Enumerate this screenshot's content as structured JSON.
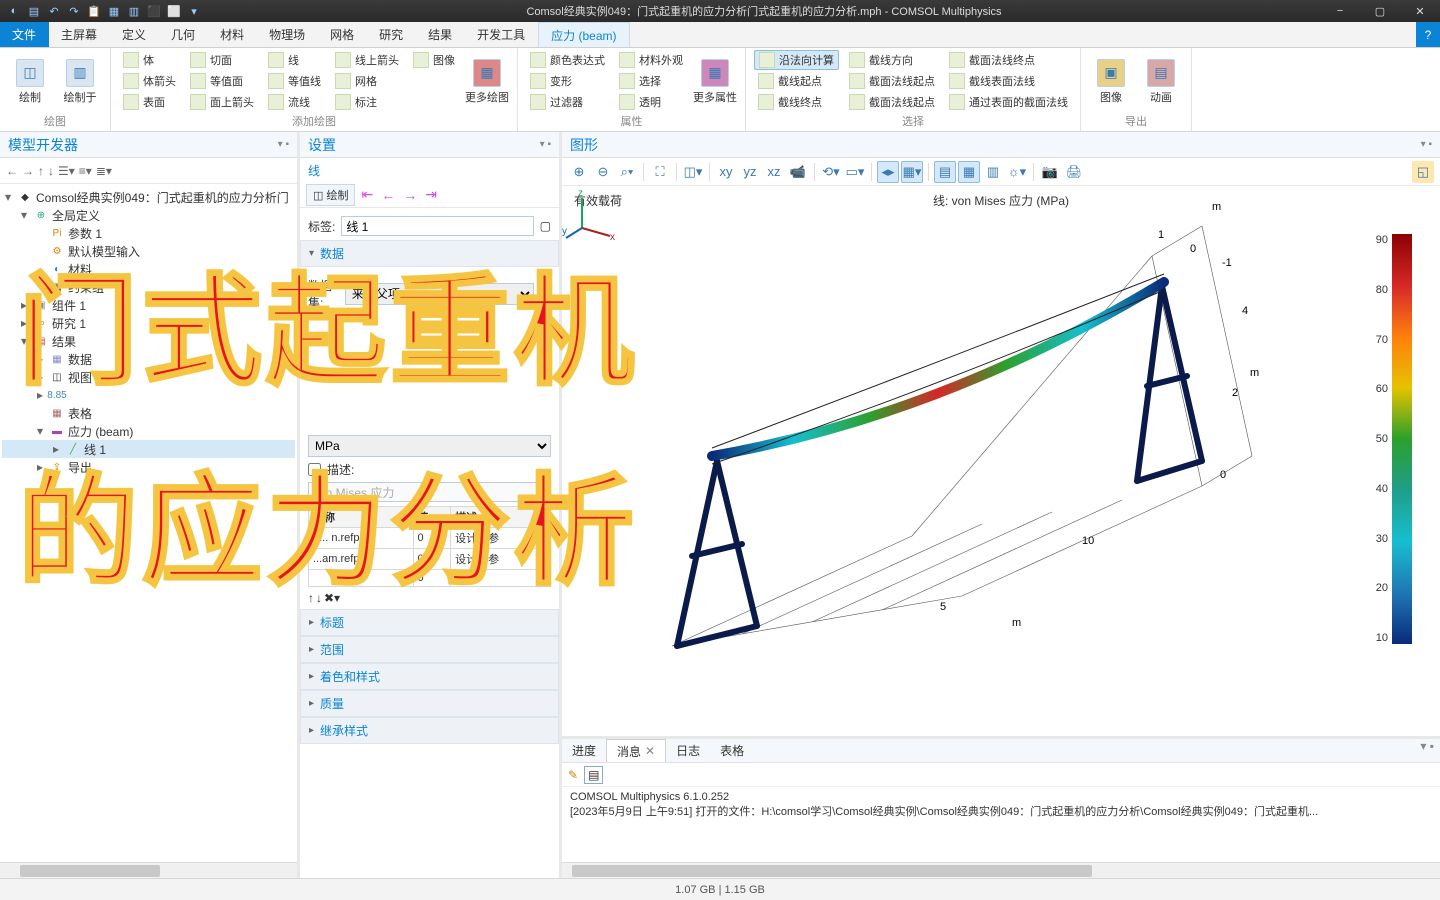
{
  "titlebar": {
    "title": "Comsol经典实例049：门式起重机的应力分析门式起重机的应力分析.mph - COMSOL Multiphysics"
  },
  "tabs": {
    "file": "文件",
    "items": [
      "主屏幕",
      "定义",
      "几何",
      "材料",
      "物理场",
      "网格",
      "研究",
      "结果",
      "开发工具"
    ],
    "context": "应力 (beam)",
    "help": "?"
  },
  "ribbon": {
    "groups": {
      "plot": {
        "name": "绘图",
        "large": [
          {
            "label": "绘制"
          },
          {
            "label": "绘制于"
          }
        ]
      },
      "add": {
        "name": "添加绘图",
        "cols": [
          [
            "体",
            "体箭头",
            "表面"
          ],
          [
            "切面",
            "等值面",
            "面上箭头"
          ],
          [
            "线",
            "等值线",
            "流线"
          ],
          [
            "线上箭头",
            "网格",
            "标注"
          ],
          [
            "图像"
          ]
        ],
        "large": [
          {
            "label": "更多绘图"
          }
        ]
      },
      "attr": {
        "name": "属性",
        "items": [
          "颜色表达式",
          "变形",
          "过滤器",
          "材料外观",
          "选择",
          "透明"
        ],
        "large": [
          {
            "label": "更多属性"
          }
        ]
      },
      "select": {
        "name": "选择",
        "left": [
          "沿法向计算",
          "截线起点",
          "截线终点"
        ],
        "mid": [
          "截线方向",
          "截面法线起点",
          "截面法线起点"
        ],
        "right": [
          "截面法线终点",
          "截线表面法线",
          "通过表面的截面法线"
        ]
      },
      "export": {
        "name": "导出",
        "large": [
          {
            "label": "图像"
          },
          {
            "label": "动画"
          }
        ]
      }
    }
  },
  "modelBuilder": {
    "title": "模型开发器",
    "root": "Comsol经典实例049：门式起重机的应力分析门",
    "nodes": {
      "global": "全局定义",
      "params": "参数 1",
      "defaultInput": "默认模型输入",
      "materials": "材料",
      "loadGroup": "约束组",
      "comp": "组件 1",
      "study": "研究 1",
      "results": "结果",
      "dataset": "数据",
      "view": "视图",
      "numRes": "8.85",
      "tables": "表格",
      "stress": "应力 (beam)",
      "line1": "线 1",
      "export": "导出"
    }
  },
  "settings": {
    "title": "设置",
    "subtitle": "线",
    "plot": "绘制",
    "tagLabel": "标签:",
    "tagValue": "线 1",
    "secData": "数据",
    "dataset": "来自父项",
    "unit": "MPa",
    "descLabel": "描述:",
    "descValue": "von Mises 应力",
    "paramTable": {
      "h1": "名称",
      "h2": "值",
      "h3": "描述",
      "rows": [
        {
          "n": "h... n.refp",
          "v": "0",
          "d": "设计算参"
        },
        {
          "n": "...am.refp",
          "v": "0",
          "d": "设计算参"
        },
        {
          "n": "",
          "v": "0",
          "d": ""
        }
      ]
    },
    "collapsed": [
      "标题",
      "范围",
      "着色和样式",
      "质量",
      "继承样式"
    ]
  },
  "graphics": {
    "title": "图形",
    "plotLeft": "有效载荷",
    "plotTitle": "线: von Mises 应力 (MPa)",
    "colorTicks": [
      "90",
      "80",
      "70",
      "60",
      "50",
      "40",
      "30",
      "20",
      "10"
    ],
    "axisM": "m",
    "axisTicks": {
      "z": [
        "1",
        "0",
        "-1"
      ],
      "y": [
        "4",
        "2",
        "0"
      ],
      "x": [
        "5",
        "10"
      ]
    }
  },
  "messages": {
    "tabs": [
      "进度",
      "消息",
      "日志",
      "表格"
    ],
    "active": 1,
    "line1": "COMSOL Multiphysics 6.1.0.252",
    "line2": "[2023年5月9日 上午9:51] 打开的文件：H:\\comsol学习\\Comsol经典实例\\Comsol经典实例049：门式起重机的应力分析\\Comsol经典实例049：门式起重机..."
  },
  "status": "1.07 GB | 1.15 GB",
  "overlay": {
    "l1": "门式起重机",
    "l2": "的应力分析"
  }
}
